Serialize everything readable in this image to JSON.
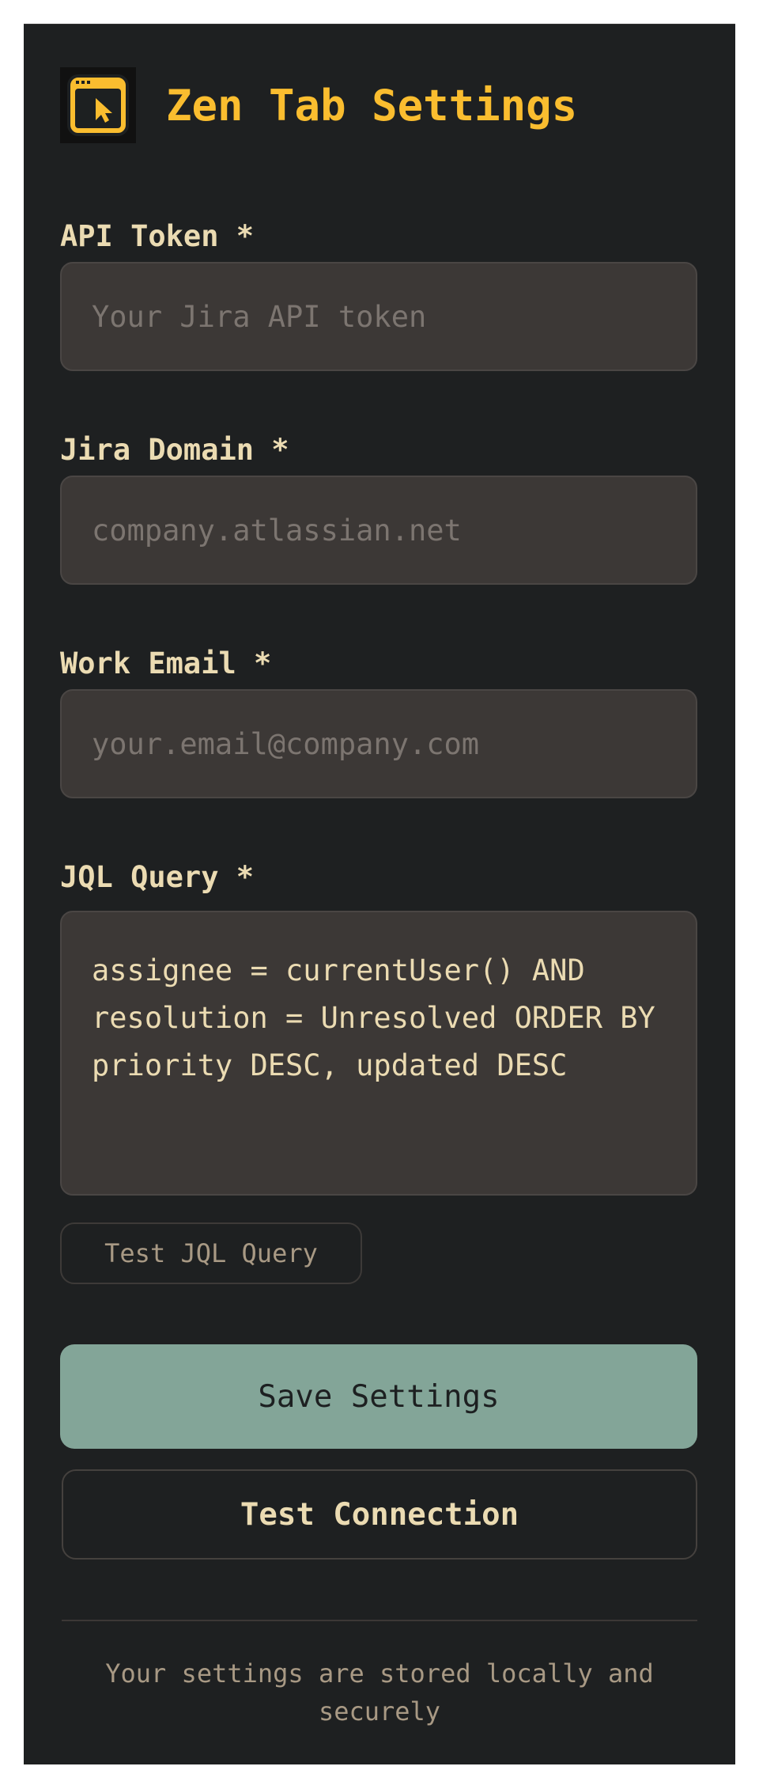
{
  "header": {
    "logo_icon": "browser-cursor-icon",
    "title": "Zen Tab Settings"
  },
  "form": {
    "api_token": {
      "label": "API Token *",
      "value": "",
      "placeholder": "Your Jira API token"
    },
    "jira_domain": {
      "label": "Jira Domain *",
      "value": "",
      "placeholder": "company.atlassian.net"
    },
    "work_email": {
      "label": "Work Email *",
      "value": "",
      "placeholder": "your.email@company.com"
    },
    "jql_query": {
      "label": "JQL Query *",
      "value": "assignee = currentUser() AND resolution = Unresolved ORDER BY priority DESC, updated DESC",
      "test_button_label": "Test JQL Query"
    }
  },
  "actions": {
    "save_label": "Save Settings",
    "test_connection_label": "Test Connection"
  },
  "footer": {
    "note": "Your settings are stored locally and securely"
  },
  "colors": {
    "background": "#1e2021",
    "accent_title": "#fabd2f",
    "input_background": "#3c3836",
    "save_button": "#83a598",
    "text": "#ebdbb2"
  }
}
